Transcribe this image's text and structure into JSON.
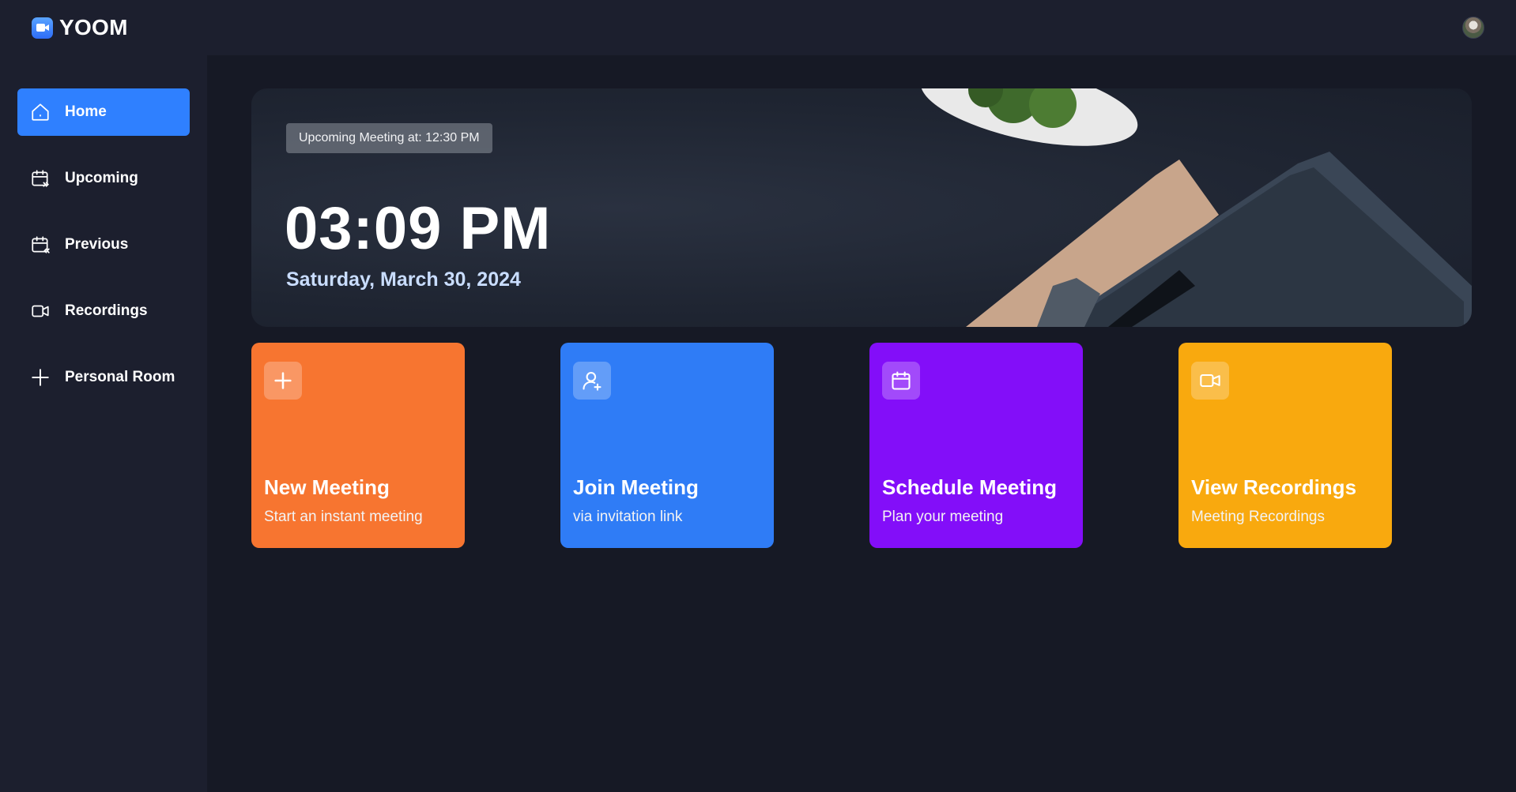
{
  "brand": {
    "name": "YOOM",
    "accent": "#2f80ff"
  },
  "sidebar": {
    "items": [
      {
        "label": "Home",
        "icon": "home-icon",
        "active": true
      },
      {
        "label": "Upcoming",
        "icon": "calendar-upcoming-icon",
        "active": false
      },
      {
        "label": "Previous",
        "icon": "calendar-previous-icon",
        "active": false
      },
      {
        "label": "Recordings",
        "icon": "video-icon",
        "active": false
      },
      {
        "label": "Personal Room",
        "icon": "plus-icon",
        "active": false
      }
    ]
  },
  "hero": {
    "chip": "Upcoming Meeting at: 12:30 PM",
    "time": "03:09 PM",
    "date": "Saturday, March 30, 2024"
  },
  "cards": [
    {
      "title": "New Meeting",
      "subtitle": "Start an instant meeting",
      "icon": "plus-icon",
      "color": "#f77530"
    },
    {
      "title": "Join Meeting",
      "subtitle": "via invitation link",
      "icon": "user-add-icon",
      "color": "#2f7cf6"
    },
    {
      "title": "Schedule Meeting",
      "subtitle": "Plan your meeting",
      "icon": "calendar-icon",
      "color": "#830ef9"
    },
    {
      "title": "View Recordings",
      "subtitle": "Meeting Recordings",
      "icon": "video-icon",
      "color": "#f9a90e"
    }
  ]
}
